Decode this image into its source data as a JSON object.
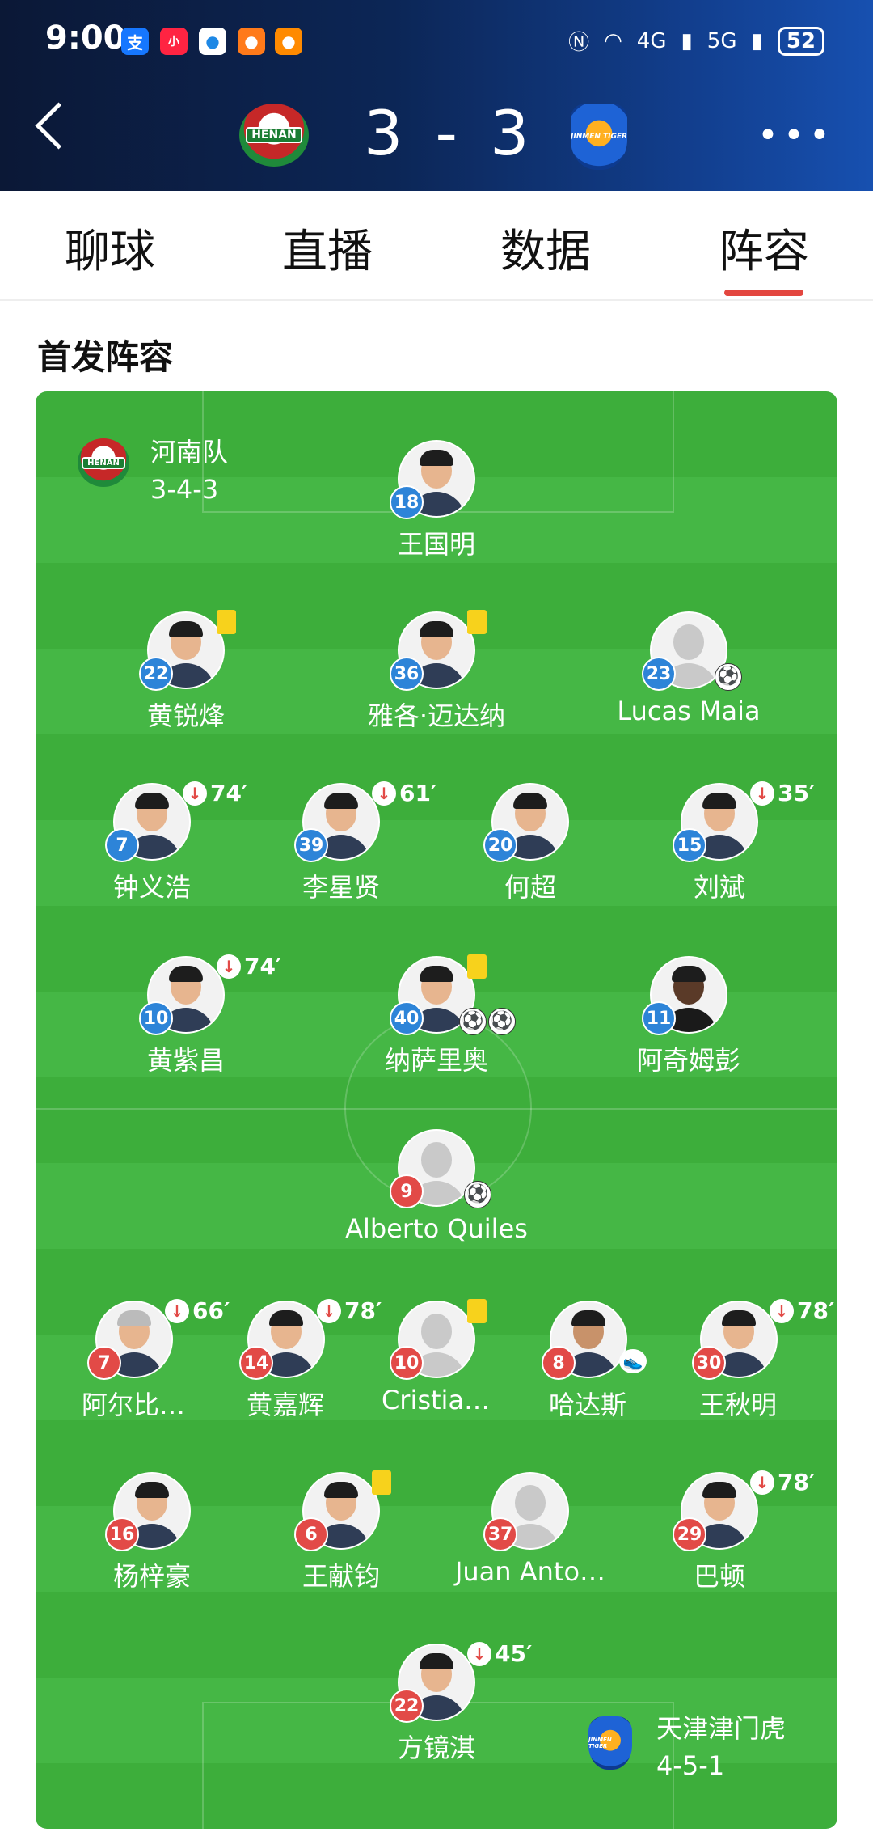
{
  "status_bar": {
    "time": "9:00",
    "apps": [
      "支",
      "小",
      "●",
      "●",
      "●"
    ],
    "battery": "52",
    "network_1": "4G",
    "network_2": "5G"
  },
  "match": {
    "home_crest_text": "HENAN",
    "away_crest_text": "JINMEN TIGER",
    "score": "3 - 3"
  },
  "tabs": [
    "聊球",
    "直播",
    "数据",
    "阵容"
  ],
  "active_tab": 3,
  "section_title": "首发阵容",
  "home_team": {
    "name": "河南队",
    "formation": "3-4-3"
  },
  "away_team": {
    "name": "天津津门虎",
    "formation": "4-5-1"
  },
  "home_players": [
    {
      "number": "18",
      "name": "王国明"
    },
    {
      "number": "22",
      "name": "黄锐烽",
      "yellow_card": true
    },
    {
      "number": "36",
      "name": "雅各·迈达纳",
      "yellow_card": true
    },
    {
      "number": "23",
      "name": "Lucas Maia",
      "goal": true,
      "placeholder": true
    },
    {
      "number": "7",
      "name": "钟义浩",
      "sub_minute": "74′"
    },
    {
      "number": "39",
      "name": "李星贤",
      "sub_minute": "61′"
    },
    {
      "number": "20",
      "name": "何超"
    },
    {
      "number": "15",
      "name": "刘斌",
      "sub_minute": "35′"
    },
    {
      "number": "10",
      "name": "黄紫昌",
      "sub_minute": "74′"
    },
    {
      "number": "40",
      "name": "纳萨里奥",
      "yellow_card": true,
      "own_goal": true,
      "goal": true
    },
    {
      "number": "11",
      "name": "阿奇姆彭"
    }
  ],
  "away_players": [
    {
      "number": "9",
      "name": "Alberto Quiles",
      "goal": true,
      "placeholder": true
    },
    {
      "number": "7",
      "name": "阿尔比…",
      "sub_minute": "66′"
    },
    {
      "number": "14",
      "name": "黄嘉辉",
      "sub_minute": "78′"
    },
    {
      "number": "10",
      "name": "Cristia…",
      "yellow_card": true,
      "placeholder": true
    },
    {
      "number": "8",
      "name": "哈达斯",
      "assist": true
    },
    {
      "number": "30",
      "name": "王秋明",
      "sub_minute": "78′"
    },
    {
      "number": "16",
      "name": "杨梓豪"
    },
    {
      "number": "6",
      "name": "王献钧",
      "yellow_card": true
    },
    {
      "number": "37",
      "name": "Juan Anto…",
      "placeholder": true
    },
    {
      "number": "29",
      "name": "巴顿",
      "sub_minute": "78′"
    },
    {
      "number": "22",
      "name": "方镜淇",
      "sub_minute": "45′"
    }
  ],
  "colors": {
    "home_number": "#2d84d8",
    "away_number": "#e24a47",
    "tab_indicator": "#e3463f",
    "pitch": "#3dae3b"
  },
  "icons": {
    "back": "chevron-left-icon",
    "more": "more-icon",
    "sub_off": "arrow-down-icon",
    "goal": "ball-icon",
    "card": "yellow-card-icon",
    "assist": "boot-icon"
  }
}
